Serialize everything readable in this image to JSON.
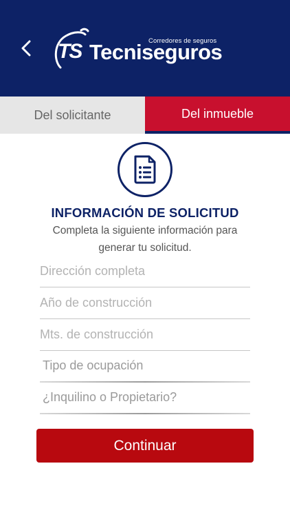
{
  "header": {
    "logo_tagline": "Corredores de seguros",
    "logo_monogram": "TS",
    "logo_name": "Tecniseguros",
    "back_icon": "chevron-left-icon"
  },
  "tabs": [
    {
      "label": "Del solicitante",
      "active": false
    },
    {
      "label": "Del inmueble",
      "active": true
    }
  ],
  "form_section": {
    "icon": "document-list-icon",
    "title": "INFORMACIÓN DE SOLICITUD",
    "subtitle": "Completa la siguiente información para generar tu solicitud."
  },
  "fields": [
    {
      "placeholder": "Dirección completa",
      "value": ""
    },
    {
      "placeholder": "Año de construcción",
      "value": ""
    },
    {
      "placeholder": "Mts. de construcción",
      "value": ""
    },
    {
      "placeholder": "Tipo de ocupación",
      "value": ""
    },
    {
      "placeholder": "¿Inquilino o Propietario?",
      "value": ""
    }
  ],
  "continue_label": "Continuar",
  "colors": {
    "brand_navy": "#0d2266",
    "brand_red": "#c8102e",
    "button_red": "#b8090f"
  }
}
